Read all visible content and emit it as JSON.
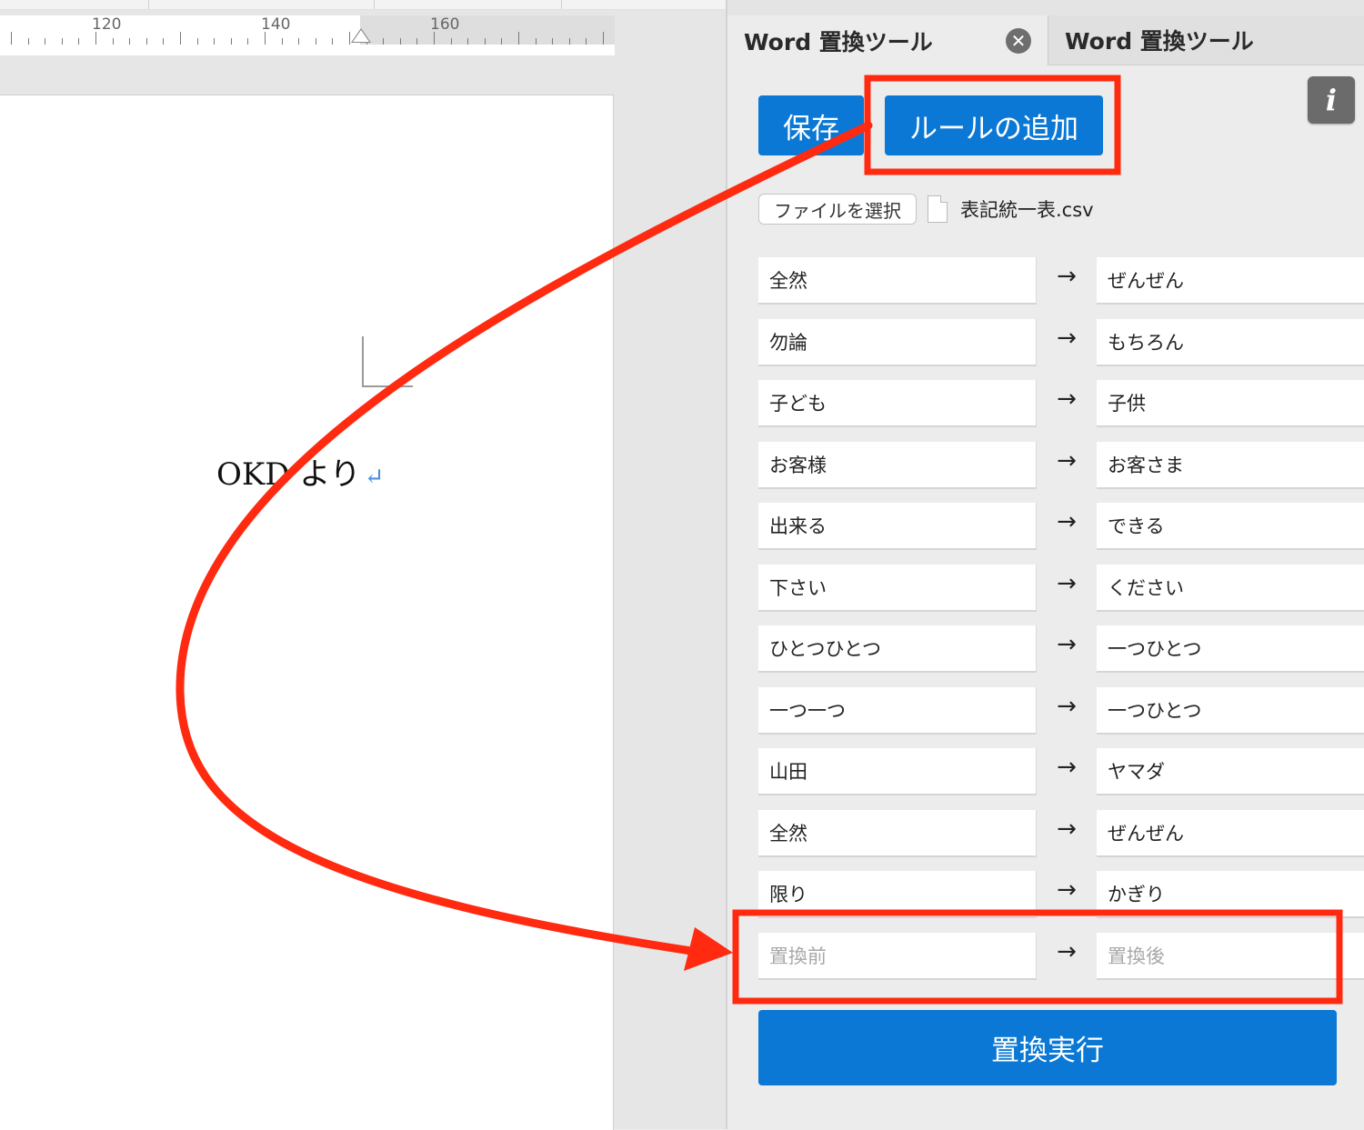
{
  "ruler": {
    "labels": [
      "120",
      "140",
      "160"
    ]
  },
  "document": {
    "text": "OKD より",
    "return_mark": "↵"
  },
  "tabs": {
    "active": "Word 置換ツール",
    "inactive": "Word 置換ツール",
    "close": "✕"
  },
  "info": {
    "label": "i"
  },
  "toolbar": {
    "save_label": "保存",
    "add_rule_label": "ルールの追加"
  },
  "file": {
    "button_label": "ファイルを選択",
    "file_name": "表記統一表.csv"
  },
  "arrow_glyph": "→",
  "rules": [
    {
      "before": "全然",
      "after": "ぜんぜん"
    },
    {
      "before": "勿論",
      "after": "もちろん"
    },
    {
      "before": "子ども",
      "after": "子供"
    },
    {
      "before": "お客様",
      "after": "お客さま"
    },
    {
      "before": "出来る",
      "after": "できる"
    },
    {
      "before": "下さい",
      "after": "ください"
    },
    {
      "before": "ひとつひとつ",
      "after": "一つひとつ"
    },
    {
      "before": "一つ一つ",
      "after": "一つひとつ"
    },
    {
      "before": "山田",
      "after": "ヤマダ"
    },
    {
      "before": "全然",
      "after": "ぜんぜん"
    },
    {
      "before": "限り",
      "after": "かぎり"
    }
  ],
  "new_rule": {
    "before_placeholder": "置換前",
    "after_placeholder": "置換後"
  },
  "run_button_label": "置換実行",
  "colors": {
    "accent": "#0a78d4",
    "annotation": "#ff2a10"
  }
}
